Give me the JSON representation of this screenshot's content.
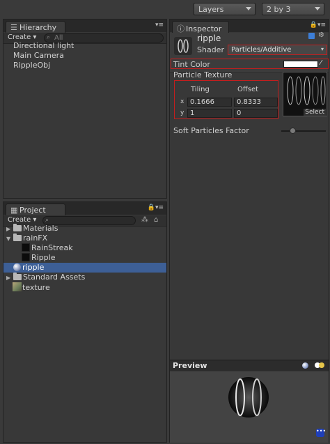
{
  "toolbar": {
    "layers_label": "Layers",
    "layout_label": "2 by 3"
  },
  "hierarchy": {
    "tab_title": "Hierarchy",
    "create_label": "Create",
    "search_placeholder": "All",
    "items": [
      "Directional light",
      "Main Camera",
      "RippleObj"
    ]
  },
  "project": {
    "tab_title": "Project",
    "create_label": "Create",
    "items": [
      {
        "label": "Materials",
        "type": "folder",
        "expanded": false
      },
      {
        "label": "rainFX",
        "type": "folder",
        "expanded": true
      },
      {
        "label": "RainStreak",
        "type": "texture-black"
      },
      {
        "label": "Ripple",
        "type": "texture-black"
      },
      {
        "label": "ripple",
        "type": "material",
        "selected": true
      },
      {
        "label": "Standard Assets",
        "type": "folder",
        "expanded": false
      },
      {
        "label": "texture",
        "type": "texture"
      }
    ]
  },
  "inspector": {
    "tab_title": "Inspector",
    "material_name": "ripple",
    "shader_label": "Shader",
    "shader_value": "Particles/Additive",
    "tint_color_label": "Tint Color",
    "tint_color_value": "#ffffff",
    "particle_texture_label": "Particle Texture",
    "tiling_label": "Tiling",
    "offset_label": "Offset",
    "x_label": "x",
    "y_label": "y",
    "tiling_x": "0.1666",
    "tiling_y": "1",
    "offset_x": "0.8333",
    "offset_y": "0",
    "select_label": "Select",
    "soft_particles_label": "Soft Particles Factor",
    "soft_particles_value": 0.25
  },
  "preview": {
    "title": "Preview"
  },
  "colors": {
    "selection": "#3d5f96",
    "highlight_border": "#c41e1e"
  }
}
